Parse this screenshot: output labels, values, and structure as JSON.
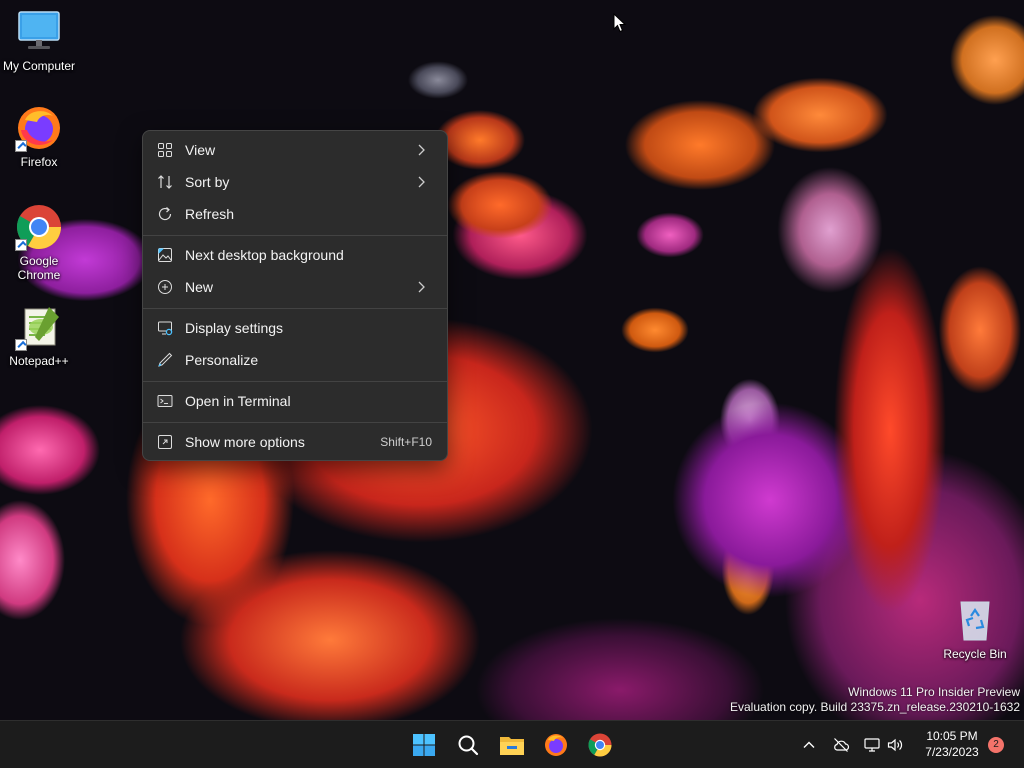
{
  "desktop": {
    "icons": [
      {
        "label": "My Computer",
        "icon": "monitor-icon"
      },
      {
        "label": "Firefox",
        "icon": "firefox-icon"
      },
      {
        "label": "Google Chrome",
        "icon": "chrome-icon"
      },
      {
        "label": "Notepad++",
        "icon": "notepadpp-icon"
      },
      {
        "label": "Recycle Bin",
        "icon": "recycle-bin-icon"
      }
    ],
    "watermark": {
      "line1": "Windows 11 Pro Insider Preview",
      "line2": "Evaluation copy. Build 23375.zn_release.230210-1632"
    }
  },
  "context_menu": {
    "items": [
      {
        "label": "View",
        "icon": "grid-icon",
        "submenu": true
      },
      {
        "label": "Sort by",
        "icon": "sort-icon",
        "submenu": true
      },
      {
        "label": "Refresh",
        "icon": "refresh-icon",
        "submenu": false
      },
      {
        "label": "Next desktop background",
        "icon": "wallpaper-icon",
        "submenu": false
      },
      {
        "label": "New",
        "icon": "plus-circle-icon",
        "submenu": true
      },
      {
        "label": "Display settings",
        "icon": "display-settings-icon",
        "submenu": false
      },
      {
        "label": "Personalize",
        "icon": "pen-icon",
        "submenu": false
      },
      {
        "label": "Open in Terminal",
        "icon": "terminal-icon",
        "submenu": false
      },
      {
        "label": "Show more options",
        "icon": "more-options-icon",
        "shortcut": "Shift+F10",
        "submenu": false
      }
    ]
  },
  "taskbar": {
    "pinned": [
      "start-icon",
      "search-icon",
      "file-explorer-icon",
      "firefox-icon",
      "chrome-icon"
    ],
    "tray": [
      "chevron-up-icon",
      "cloud-offline-icon",
      "network-icon",
      "volume-icon"
    ],
    "time": "10:05 PM",
    "date": "7/23/2023",
    "notification_count": "2"
  },
  "colors": {
    "menu_bg": "#2c2c2c",
    "taskbar_bg": "#1c1c1c",
    "accent": "#0078d4",
    "badge": "#f4736a"
  }
}
